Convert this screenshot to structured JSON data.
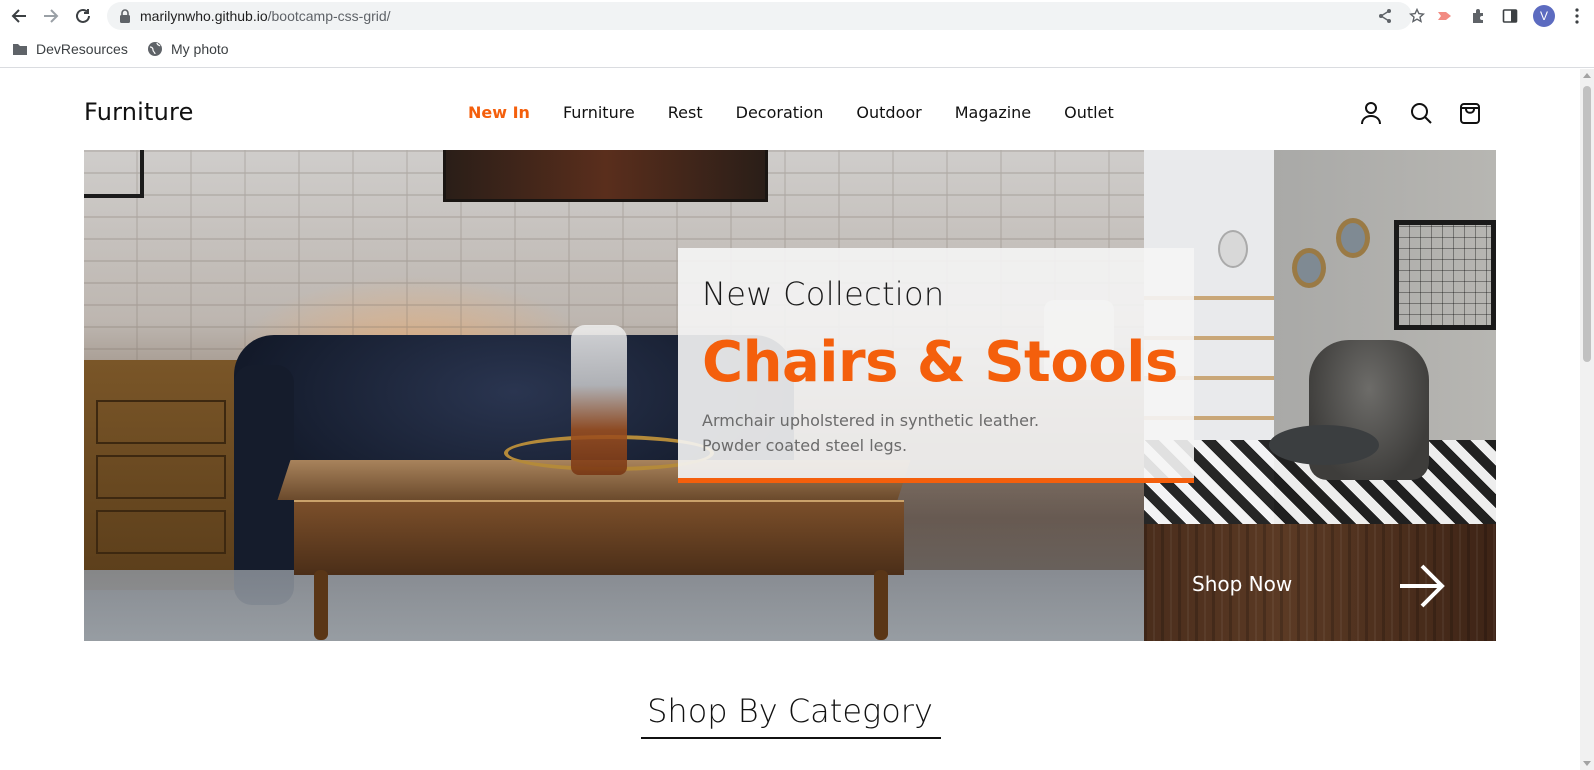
{
  "browser": {
    "url_host": "marilynwho.github.io",
    "url_path": "/bootcamp-css-grid/",
    "avatar_letter": "V",
    "bookmarks": [
      {
        "label": "DevResources",
        "icon": "folder-icon"
      },
      {
        "label": "My photo",
        "icon": "globe-icon"
      }
    ]
  },
  "header": {
    "logo": "Furniture",
    "nav": [
      {
        "label": "New In",
        "active": true
      },
      {
        "label": "Furniture",
        "active": false
      },
      {
        "label": "Rest",
        "active": false
      },
      {
        "label": "Decoration",
        "active": false
      },
      {
        "label": "Outdoor",
        "active": false
      },
      {
        "label": "Magazine",
        "active": false
      },
      {
        "label": "Outlet",
        "active": false
      }
    ],
    "icons": [
      "user-icon",
      "search-icon",
      "shopping-bag-icon"
    ]
  },
  "hero": {
    "kicker": "New Collection",
    "title": "Chairs & Stools",
    "description_line1": "Armchair upholstered in synthetic leather.",
    "description_line2": "Powder coated steel legs.",
    "cta_label": "Shop Now"
  },
  "section": {
    "title": "Shop By Category"
  },
  "colors": {
    "accent": "#f45f0c",
    "text": "#111111",
    "muted": "#6b6b6b"
  }
}
